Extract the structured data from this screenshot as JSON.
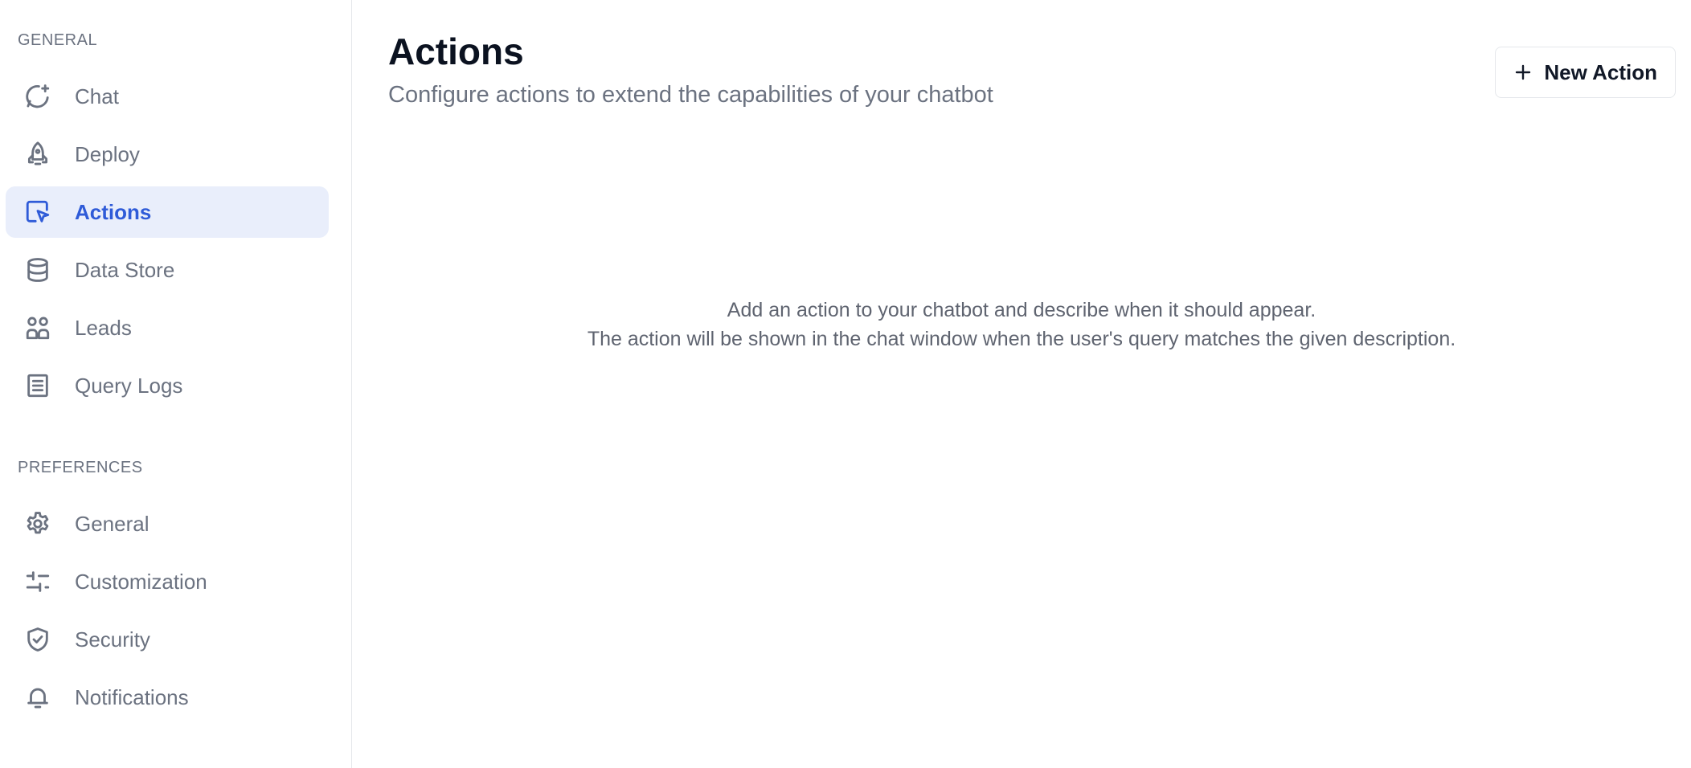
{
  "sidebar": {
    "general_label": "GENERAL",
    "general_items": [
      {
        "label": "Chat",
        "icon": "chat-sparkle-icon",
        "active": false
      },
      {
        "label": "Deploy",
        "icon": "rocket-icon",
        "active": false
      },
      {
        "label": "Actions",
        "icon": "cursor-click-icon",
        "active": true
      },
      {
        "label": "Data Store",
        "icon": "database-icon",
        "active": false
      },
      {
        "label": "Leads",
        "icon": "users-grid-icon",
        "active": false
      },
      {
        "label": "Query Logs",
        "icon": "document-list-icon",
        "active": false
      }
    ],
    "preferences_label": "PREFERENCES",
    "preferences_items": [
      {
        "label": "General",
        "icon": "gear-icon",
        "active": false
      },
      {
        "label": "Customization",
        "icon": "sliders-icon",
        "active": false
      },
      {
        "label": "Security",
        "icon": "shield-check-icon",
        "active": false
      },
      {
        "label": "Notifications",
        "icon": "bell-icon",
        "active": false
      }
    ]
  },
  "main": {
    "title": "Actions",
    "subtitle": "Configure actions to extend the capabilities of your chatbot",
    "new_action_label": "New Action",
    "empty_line_1": "Add an action to your chatbot and describe when it should appear.",
    "empty_line_2": "The action will be shown in the chat window when the user's query matches the given description."
  },
  "colors": {
    "active_bg": "#e9eefb",
    "active_text": "#2f5bd8",
    "muted_text": "#6b7280"
  }
}
